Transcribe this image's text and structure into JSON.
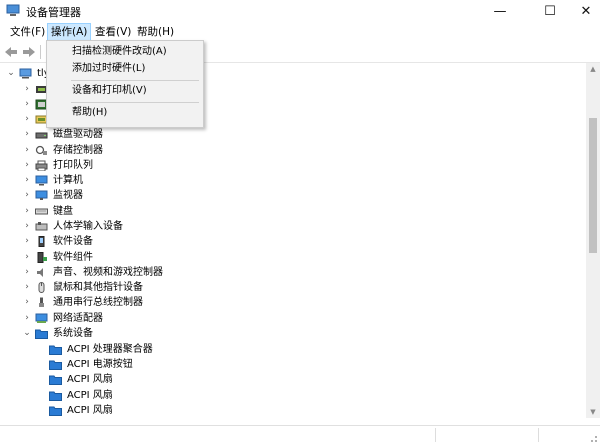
{
  "window": {
    "title": "设备管理器",
    "minimize": "—",
    "maximize": "☐",
    "close": "✕"
  },
  "menubar": [
    {
      "label": "文件(F)",
      "active": false
    },
    {
      "label": "操作(A)",
      "active": true
    },
    {
      "label": "查看(V)",
      "active": false
    },
    {
      "label": "帮助(H)",
      "active": false
    }
  ],
  "dropdown": [
    {
      "label": "扫描检测硬件改动(A)"
    },
    {
      "label": "添加过时硬件(L)"
    },
    {
      "label": "设备和打印机(V)"
    },
    {
      "label": "帮助(H)"
    }
  ],
  "tree": {
    "root": {
      "label": "tly",
      "icon": "computer-root-icon"
    },
    "categories": [
      {
        "label": "",
        "icon": "category-icon-1"
      },
      {
        "label": "",
        "icon": "category-icon-2"
      },
      {
        "label": "",
        "icon": "category-icon-3"
      },
      {
        "label": "磁盘驱动器",
        "icon": "disk-drive-icon"
      },
      {
        "label": "存储控制器",
        "icon": "storage-controller-icon"
      },
      {
        "label": "打印队列",
        "icon": "print-queue-icon"
      },
      {
        "label": "计算机",
        "icon": "computer-icon"
      },
      {
        "label": "监视器",
        "icon": "monitor-icon"
      },
      {
        "label": "键盘",
        "icon": "keyboard-icon"
      },
      {
        "label": "人体学输入设备",
        "icon": "hid-icon"
      },
      {
        "label": "软件设备",
        "icon": "software-device-icon"
      },
      {
        "label": "软件组件",
        "icon": "software-component-icon"
      },
      {
        "label": "声音、视频和游戏控制器",
        "icon": "sound-icon"
      },
      {
        "label": "鼠标和其他指针设备",
        "icon": "mouse-icon"
      },
      {
        "label": "通用串行总线控制器",
        "icon": "usb-icon"
      },
      {
        "label": "网络适配器",
        "icon": "network-adapter-icon"
      },
      {
        "label": "系统设备",
        "icon": "system-device-icon",
        "expanded": true
      }
    ],
    "system_children": [
      {
        "label": "ACPI 处理器聚合器"
      },
      {
        "label": "ACPI 电源按钮"
      },
      {
        "label": "ACPI 风扇"
      },
      {
        "label": "ACPI 风扇"
      },
      {
        "label": "ACPI 风扇"
      }
    ]
  },
  "colors": {
    "menu_active_bg": "#cce8ff",
    "menu_active_border": "#99d1ff",
    "dropdown_bg": "#f2f2f2",
    "folder_blue": "#2a7bd4"
  }
}
